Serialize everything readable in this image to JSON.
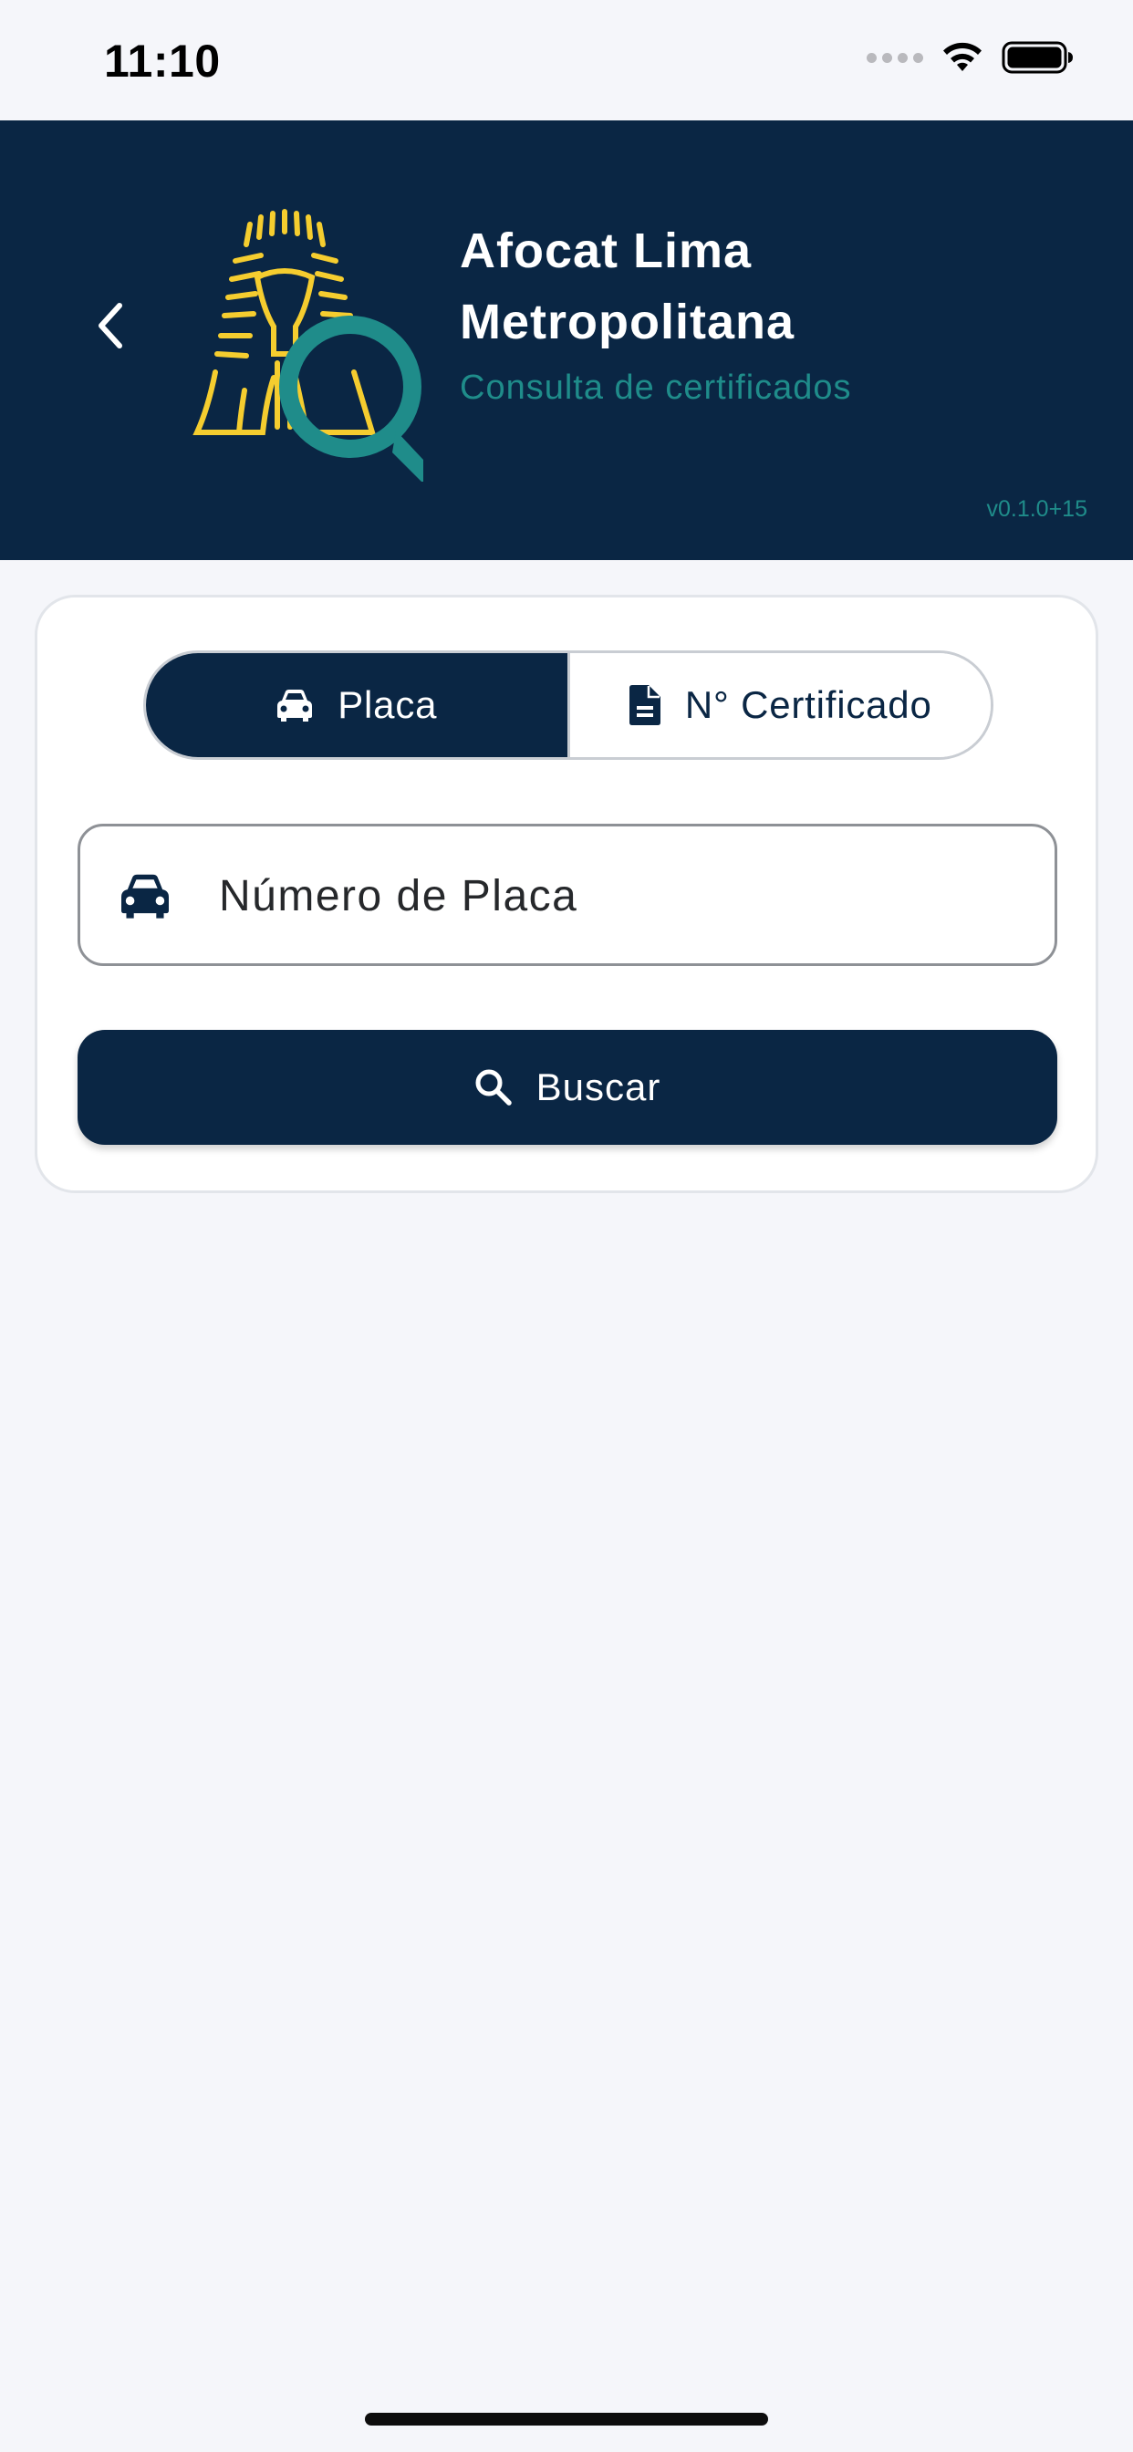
{
  "status_bar": {
    "time": "11:10",
    "icons": [
      "signal-icon",
      "wifi-icon",
      "battery-icon"
    ]
  },
  "header": {
    "back_icon": "chevron-left-icon",
    "logo": "afocat-pharaoh-search-logo",
    "title": "Afocat Lima Metropolitana",
    "subtitle": "Consulta de certificados",
    "version": "v0.1.0+15"
  },
  "search_card": {
    "tabs": [
      {
        "label": "Placa",
        "icon": "car-icon",
        "selected": true
      },
      {
        "label": "N° Certificado",
        "icon": "document-icon",
        "selected": false
      }
    ],
    "input": {
      "icon": "car-icon",
      "value": "",
      "placeholder": "Número de Placa"
    },
    "button": {
      "label": "Buscar",
      "icon": "search-icon"
    }
  },
  "colors": {
    "primary": "#0a2644",
    "accent_teal": "#1f8c8a",
    "logo_yellow": "#f5cd2f",
    "background": "#f5f6fa"
  }
}
